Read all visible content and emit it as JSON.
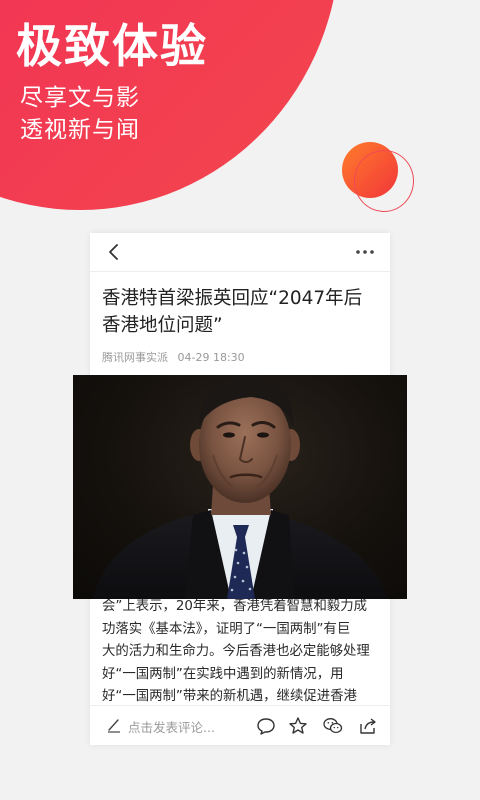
{
  "promo": {
    "headline": "极致体验",
    "subline_1": "尽享文与影",
    "subline_2": "透视新与闻"
  },
  "article": {
    "title_line_1": "香港特首梁振英回应“2047年后",
    "title_line_2": "香港地位问题”",
    "source": "腾讯网事实派",
    "time": "04-29 18:30",
    "body_lines": [
      "会”上表示，20年来，香港凭着智慧和毅力成",
      "功落实《基本法》，证明了“一国两制”有巨",
      "大的活力和生命力。今后香港也必定能够处理",
      "好“一国两制”在实践中遇到的新情况，用",
      "好“一国两制”带来的新机遇，继续促进香港"
    ]
  },
  "toolbar": {
    "back_icon": "chevron-left-icon",
    "more_icon": "ellipsis-icon"
  },
  "bottom_bar": {
    "comment_placeholder": "点击发表评论...",
    "icons": [
      "pen-icon",
      "comment-icon",
      "star-icon",
      "wechat-icon",
      "share-icon"
    ]
  },
  "colors": {
    "brand_red": "#ee2d57",
    "orb_orange": "#ff7d2b"
  }
}
